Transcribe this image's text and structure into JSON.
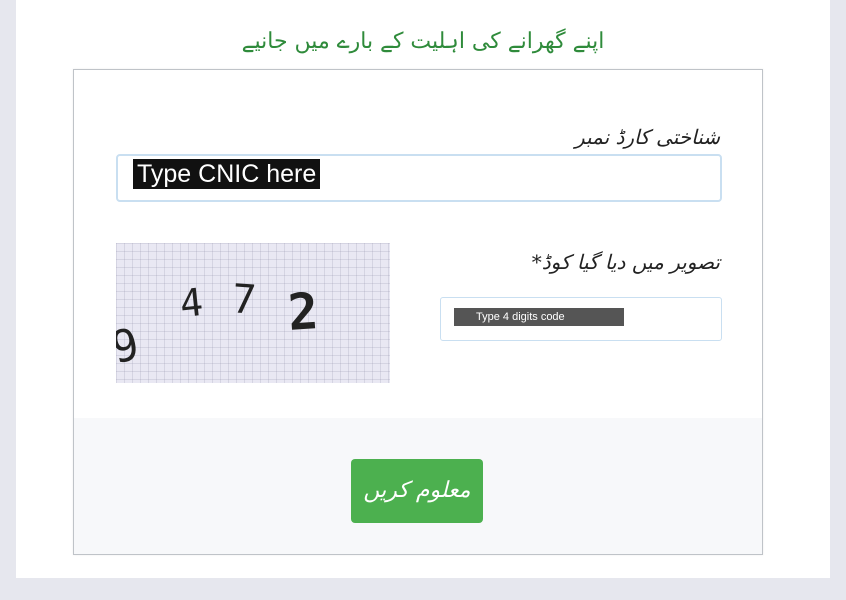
{
  "heading": "اپنے گھرانے کی اہلیت کے بارے میں جانیے",
  "form": {
    "cnic_label": "شناختی کارڈ نمبر",
    "cnic_placeholder": "Type CNIC here",
    "captcha_label": "تصویر میں دیا گیا کوڈ*",
    "captcha_chars": [
      "9",
      "4",
      "7",
      "2"
    ],
    "code_placeholder": "Type 4 digits code",
    "submit_label": "معلوم کریں"
  },
  "colors": {
    "accent_green": "#4cb04f",
    "heading_green": "#2f8b3b",
    "input_border": "#c9dff1"
  }
}
